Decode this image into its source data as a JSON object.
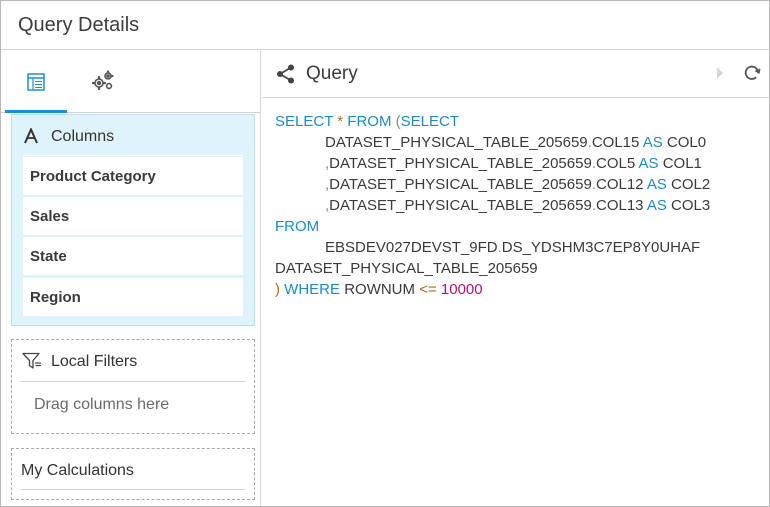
{
  "window": {
    "title": "Query Details"
  },
  "left_panel": {
    "tabs": [
      {
        "name": "columns-tab",
        "icon": "table-icon",
        "active": true
      },
      {
        "name": "settings-tab",
        "icon": "gears-icon",
        "active": false
      }
    ],
    "columns": {
      "header": "Columns",
      "icon": "attribute-a-icon",
      "items": [
        "Product Category",
        "Sales",
        "State",
        "Region"
      ]
    },
    "local_filters": {
      "header": "Local Filters",
      "icon": "filter-icon",
      "placeholder": "Drag columns here"
    },
    "calculations": {
      "header": "My Calculations"
    }
  },
  "query_panel": {
    "title": "Query",
    "icons": {
      "share": "share-icon",
      "run": "play-icon",
      "refresh": "refresh-icon"
    },
    "sql": {
      "line1_kw1": "SELECT",
      "line1_star": " * ",
      "line1_kw2": "FROM",
      "line1_paren": " (",
      "line1_kw3": "SELECT",
      "col_table": "DATASET_PHYSICAL_TABLE_205659",
      "col15": "COL15",
      "col5": "COL5",
      "col12": "COL12",
      "col13": "COL13",
      "as_kw": "AS",
      "alias0": "COL0",
      "alias1": "COL1",
      "alias2": "COL2",
      "alias3": "COL3",
      "from_kw": "FROM",
      "schema": "EBSDEV027DEVST_9FD",
      "dataset": "DS_YDSHM3C7EP8Y0UHAF",
      "table_alias": "DATASET_PHYSICAL_TABLE_205659",
      "close_paren": ")",
      "where_kw": "WHERE",
      "rownum": "ROWNUM",
      "lte": "<=",
      "limit": "10000"
    }
  },
  "colors": {
    "accent": "#1f8dd6",
    "keyword": "#1f8bbf",
    "number": "#b4127a",
    "operator": "#b46b1e",
    "columns_bg": "#dff3fb"
  }
}
